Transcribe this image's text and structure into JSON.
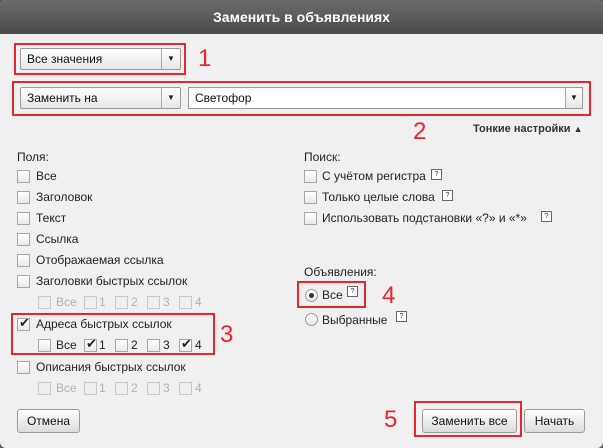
{
  "dialog": {
    "title": "Заменить в объявлениях"
  },
  "scope_select": {
    "value": "Все значения"
  },
  "action_select": {
    "value": "Заменить на"
  },
  "replace_input": {
    "value": "Светофор"
  },
  "fine_settings": {
    "label": "Тонкие настройки"
  },
  "fields": {
    "heading": "Поля:",
    "items": [
      "Все",
      "Заголовок",
      "Текст",
      "Ссылка",
      "Отображаемая ссылка",
      "Заголовки быстрых ссылок",
      "Адреса быстрых ссылок",
      "Описания быстрых ссылок"
    ],
    "checked": [
      false,
      false,
      false,
      false,
      false,
      false,
      true,
      false
    ],
    "sub_labels": [
      "Все",
      "1",
      "2",
      "3",
      "4"
    ],
    "quick_titles_sub_checked": [
      false,
      false,
      false,
      false,
      false
    ],
    "quick_urls_sub_checked": [
      false,
      true,
      false,
      false,
      true
    ],
    "quick_desc_sub_checked": [
      false,
      false,
      false,
      false,
      false
    ]
  },
  "search": {
    "heading": "Поиск:",
    "items": [
      "С учётом регистра",
      "Только целые слова",
      "Использовать подстановки «?» и «*»"
    ],
    "checked": [
      false,
      false,
      false
    ]
  },
  "ads": {
    "heading": "Объявления:",
    "options": [
      "Все",
      "Выбранные"
    ],
    "selected": "Все"
  },
  "buttons": {
    "cancel": "Отмена",
    "replace_all": "Заменить все",
    "start": "Начать"
  },
  "annotations": [
    "1",
    "2",
    "3",
    "4",
    "5"
  ],
  "colors": {
    "annotation": "#e8262c",
    "title_bar": "#555555",
    "dialog_bg": "#f0f0f0"
  },
  "icons": {
    "dropdown": "▼",
    "help": "?",
    "check": "✔",
    "expand": "▲"
  }
}
